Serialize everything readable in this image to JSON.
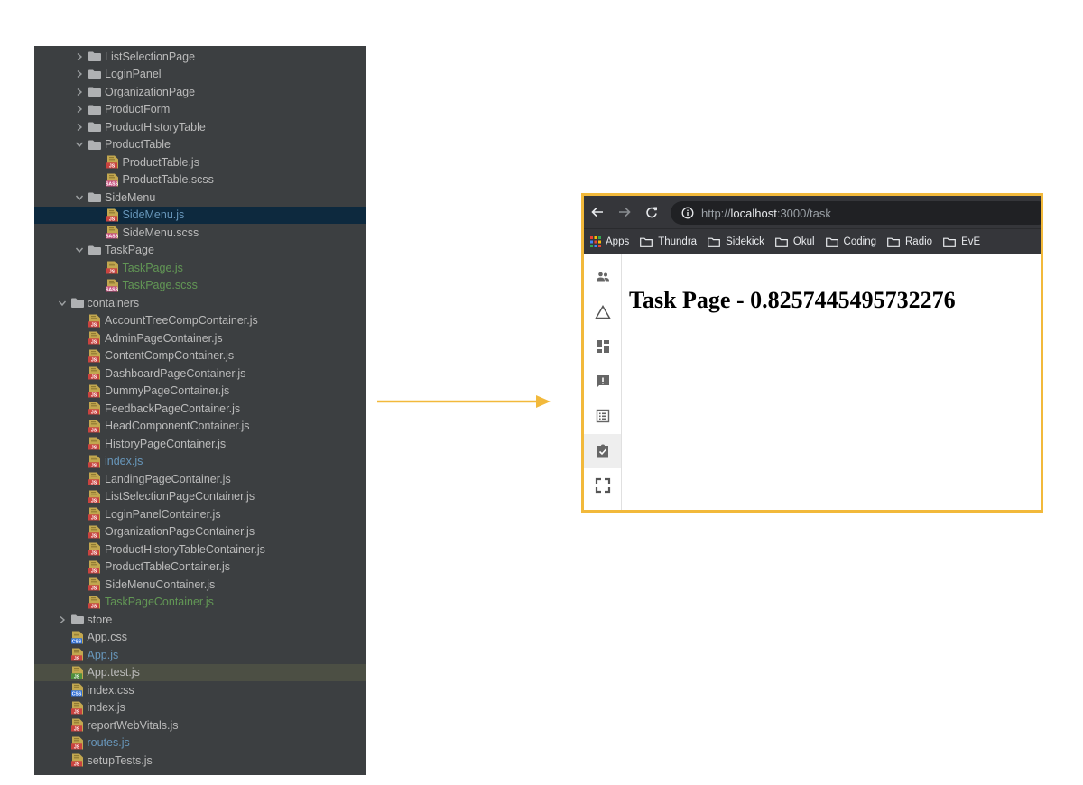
{
  "project_tree": {
    "rows": [
      {
        "label": "ListSelectionPage",
        "kind": "folder",
        "state": "collapsed",
        "depth": 4
      },
      {
        "label": "LoginPanel",
        "kind": "folder",
        "state": "collapsed",
        "depth": 4
      },
      {
        "label": "OrganizationPage",
        "kind": "folder",
        "state": "collapsed",
        "depth": 4
      },
      {
        "label": "ProductForm",
        "kind": "folder",
        "state": "collapsed",
        "depth": 4
      },
      {
        "label": "ProductHistoryTable",
        "kind": "folder",
        "state": "collapsed",
        "depth": 4
      },
      {
        "label": "ProductTable",
        "kind": "folder",
        "state": "expanded",
        "depth": 4
      },
      {
        "label": "ProductTable.js",
        "kind": "js",
        "depth": 5
      },
      {
        "label": "ProductTable.scss",
        "kind": "scss",
        "depth": 5
      },
      {
        "label": "SideMenu",
        "kind": "folder",
        "state": "expanded",
        "depth": 4
      },
      {
        "label": "SideMenu.js",
        "kind": "js",
        "depth": 5,
        "color": "blue",
        "selected": true
      },
      {
        "label": "SideMenu.scss",
        "kind": "scss",
        "depth": 5
      },
      {
        "label": "TaskPage",
        "kind": "folder",
        "state": "expanded",
        "depth": 4
      },
      {
        "label": "TaskPage.js",
        "kind": "js",
        "depth": 5,
        "color": "green"
      },
      {
        "label": "TaskPage.scss",
        "kind": "scss",
        "depth": 5,
        "color": "green"
      },
      {
        "label": "containers",
        "kind": "folder",
        "state": "expanded",
        "depth": 3
      },
      {
        "label": "AccountTreeCompContainer.js",
        "kind": "js",
        "depth": 4
      },
      {
        "label": "AdminPageContainer.js",
        "kind": "js",
        "depth": 4
      },
      {
        "label": "ContentCompContainer.js",
        "kind": "js",
        "depth": 4
      },
      {
        "label": "DashboardPageContainer.js",
        "kind": "js",
        "depth": 4
      },
      {
        "label": "DummyPageContainer.js",
        "kind": "js",
        "depth": 4
      },
      {
        "label": "FeedbackPageContainer.js",
        "kind": "js",
        "depth": 4
      },
      {
        "label": "HeadComponentContainer.js",
        "kind": "js",
        "depth": 4
      },
      {
        "label": "HistoryPageContainer.js",
        "kind": "js",
        "depth": 4
      },
      {
        "label": "index.js",
        "kind": "js",
        "depth": 4,
        "color": "blue"
      },
      {
        "label": "LandingPageContainer.js",
        "kind": "js",
        "depth": 4
      },
      {
        "label": "ListSelectionPageContainer.js",
        "kind": "js",
        "depth": 4
      },
      {
        "label": "LoginPanelContainer.js",
        "kind": "js",
        "depth": 4
      },
      {
        "label": "OrganizationPageContainer.js",
        "kind": "js",
        "depth": 4
      },
      {
        "label": "ProductHistoryTableContainer.js",
        "kind": "js",
        "depth": 4
      },
      {
        "label": "ProductTableContainer.js",
        "kind": "js",
        "depth": 4
      },
      {
        "label": "SideMenuContainer.js",
        "kind": "js",
        "depth": 4
      },
      {
        "label": "TaskPageContainer.js",
        "kind": "js",
        "depth": 4,
        "color": "green"
      },
      {
        "label": "store",
        "kind": "folder",
        "state": "collapsed",
        "depth": 3
      },
      {
        "label": "App.css",
        "kind": "css",
        "depth": 3
      },
      {
        "label": "App.js",
        "kind": "js",
        "depth": 3,
        "color": "blue"
      },
      {
        "label": "App.test.js",
        "kind": "test",
        "depth": 3,
        "highlight": true
      },
      {
        "label": "index.css",
        "kind": "css",
        "depth": 3
      },
      {
        "label": "index.js",
        "kind": "js",
        "depth": 3
      },
      {
        "label": "reportWebVitals.js",
        "kind": "js",
        "depth": 3
      },
      {
        "label": "routes.js",
        "kind": "js",
        "depth": 3,
        "color": "blue"
      },
      {
        "label": "setupTests.js",
        "kind": "js",
        "depth": 3
      }
    ]
  },
  "colors": {
    "ide_background": "#3c3f41",
    "ide_text": "#bbbbbb",
    "ide_blue": "#6897bb",
    "ide_green": "#629755",
    "selection": "#0d293e",
    "arrow": "#f2b93b",
    "browser_frame": "#f2b93b"
  },
  "browser": {
    "url_scheme": "http://",
    "url_host": "localhost",
    "url_path": ":3000/task",
    "bookmarks": {
      "apps": "Apps",
      "items": [
        "Thundra",
        "Sidekick",
        "Okul",
        "Coding",
        "Radio",
        "EvE"
      ]
    },
    "side_nav_icons": [
      {
        "name": "people-icon",
        "active": false
      },
      {
        "name": "triangle-icon",
        "active": false
      },
      {
        "name": "dashboard-icon",
        "active": false
      },
      {
        "name": "feedback-icon",
        "active": false
      },
      {
        "name": "list-icon",
        "active": false
      },
      {
        "name": "task-clipboard-icon",
        "active": true
      },
      {
        "name": "fullscreen-icon",
        "active": false
      }
    ],
    "heading": "Task Page - 0.8257445495732276"
  }
}
